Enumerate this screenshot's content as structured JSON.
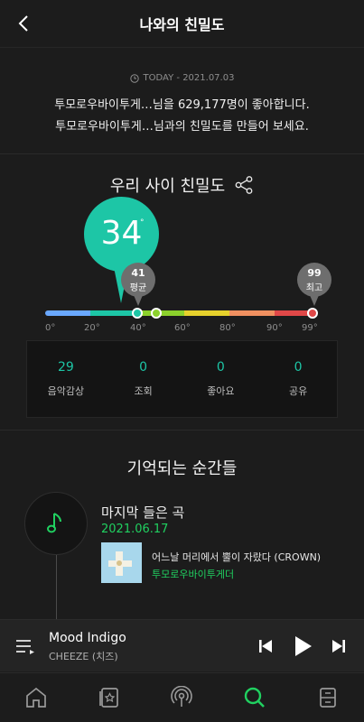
{
  "header": {
    "title": "나와의 친밀도",
    "back_icon": "chevron-left-icon"
  },
  "summary": {
    "today": "TODAY - 2021.07.03",
    "line1": "투모로우바이투게…님을 629,177명이 좋아합니다.",
    "line2": "투모로우바이투게…님과의 친밀도를 만들어 보세요."
  },
  "intimacy": {
    "title": "우리 사이 친밀도",
    "score": "34",
    "score_degree": "°",
    "average": {
      "value": "41",
      "label": "평균"
    },
    "max": {
      "value": "99",
      "label": "최고"
    },
    "scale_ticks": [
      "0°",
      "20°",
      "40°",
      "60°",
      "80°",
      "90°",
      "99°"
    ],
    "scale_colors": [
      "#6aa8ff",
      "#1dc6a6",
      "#8cd12c",
      "#e6d12c",
      "#f09060",
      "#e04848"
    ],
    "levels": {
      "score": 34,
      "average": 41,
      "max": 99
    }
  },
  "stats": [
    {
      "value": "29",
      "label": "음악감상"
    },
    {
      "value": "0",
      "label": "조회"
    },
    {
      "value": "0",
      "label": "좋아요"
    },
    {
      "value": "0",
      "label": "공유"
    }
  ],
  "moments": {
    "title": "기억되는 순간들",
    "item": {
      "title": "마지막 들은 곡",
      "date": "2021.06.17",
      "song": "어느날 머리에서 뿔이 자랐다 (CROWN)",
      "artist": "투모로우바이투게더"
    }
  },
  "player": {
    "title": "Mood Indigo",
    "artist": "CHEEZE (치즈)"
  },
  "accent": "#1dc6a6",
  "highlight_green": "#20d060"
}
